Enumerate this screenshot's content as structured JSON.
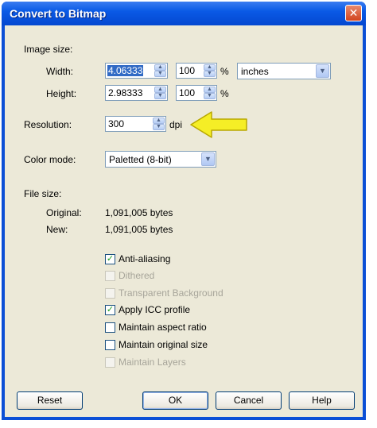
{
  "window": {
    "title": "Convert to Bitmap",
    "close_icon": "close-icon"
  },
  "image_size": {
    "heading": "Image size:",
    "width_label": "Width:",
    "width_value": "4.06333",
    "height_label": "Height:",
    "height_value": "2.98333",
    "width_percent": "100",
    "height_percent": "100",
    "percent_symbol": "%",
    "units": "inches"
  },
  "resolution": {
    "label": "Resolution:",
    "value": "300",
    "unit": "dpi"
  },
  "color_mode": {
    "label": "Color mode:",
    "value": "Paletted (8-bit)"
  },
  "file_size": {
    "heading": "File size:",
    "original_label": "Original:",
    "original_value": "1,091,005 bytes",
    "new_label": "New:",
    "new_value": "1,091,005 bytes"
  },
  "options": [
    {
      "label": "Anti-aliasing",
      "checked": true,
      "enabled": true
    },
    {
      "label": "Dithered",
      "checked": false,
      "enabled": false
    },
    {
      "label": "Transparent Background",
      "checked": false,
      "enabled": false
    },
    {
      "label": "Apply ICC profile",
      "checked": true,
      "enabled": true
    },
    {
      "label": "Maintain aspect ratio",
      "checked": false,
      "enabled": true
    },
    {
      "label": "Maintain original size",
      "checked": false,
      "enabled": true
    },
    {
      "label": "Maintain Layers",
      "checked": false,
      "enabled": false
    }
  ],
  "buttons": {
    "reset": "Reset",
    "ok": "OK",
    "cancel": "Cancel",
    "help": "Help"
  },
  "annotation": {
    "arrow_color": "#f5ee26",
    "arrow_outline": "#b9a800"
  },
  "colors": {
    "title_bar": "#0a5ae6",
    "dialog_bg": "#ece9d8",
    "selection": "#316ac5"
  }
}
